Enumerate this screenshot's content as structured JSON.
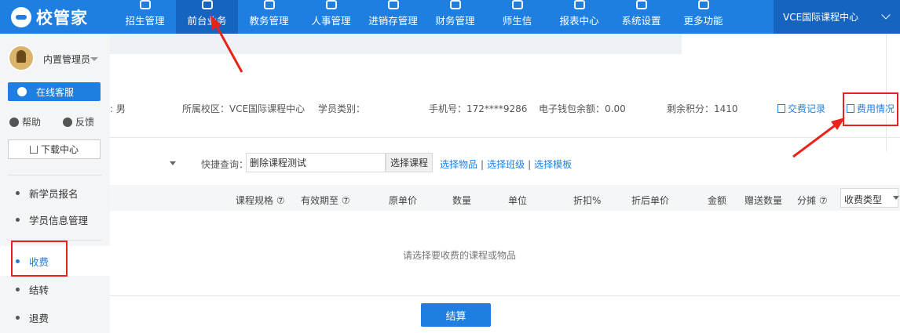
{
  "app": {
    "logo_text": "校管家"
  },
  "nav": {
    "items": [
      {
        "label": "招生管理",
        "icon": "user-add-icon"
      },
      {
        "label": "前台业务",
        "icon": "reception-icon"
      },
      {
        "label": "教务管理",
        "icon": "book-icon"
      },
      {
        "label": "人事管理",
        "icon": "person-icon"
      },
      {
        "label": "进销存管理",
        "icon": "inventory-icon"
      },
      {
        "label": "财务管理",
        "icon": "finance-icon"
      },
      {
        "label": "师生信",
        "icon": "chat-icon"
      },
      {
        "label": "报表中心",
        "icon": "report-icon"
      },
      {
        "label": "系统设置",
        "icon": "settings-icon"
      },
      {
        "label": "更多功能",
        "icon": "more-icon"
      }
    ],
    "active_index": 1,
    "campus": "VCE国际课程中心"
  },
  "sidebar": {
    "user_name": "内置管理员",
    "online_service": "在线客服",
    "help": "帮助",
    "feedback": "反馈",
    "download_center": "下载中心",
    "menu": [
      {
        "label": "新学员报名",
        "active": false
      },
      {
        "label": "学员信息管理",
        "active": false
      },
      {
        "label": "收费",
        "active": true
      },
      {
        "label": "结转",
        "active": false
      },
      {
        "label": "退费",
        "active": false
      }
    ]
  },
  "student_info": {
    "gender_partial": ": 男",
    "campus": "所属校区：VCE国际课程中心",
    "category": "学员类别：",
    "phone": "手机号：172****9286",
    "wallet": "电子钱包余额：0.00",
    "points": "剩余积分：1410",
    "payment_record": "交费记录",
    "fee_status": "费用情况"
  },
  "toolbar": {
    "quick_query_label": "快捷查询：",
    "quick_query_value": "删除课程测试",
    "select_course": "选择课程",
    "select_item": "选择物品",
    "select_class": "选择班级",
    "select_template": "选择模板",
    "separator": "|"
  },
  "table": {
    "headers": [
      "课程规格 ⑦",
      "有效期至 ⑦",
      "原单价",
      "数量",
      "单位",
      "折扣%",
      "折后单价",
      "金额",
      "赠送数量",
      "分摊 ⑦"
    ],
    "fee_type": "收费类型",
    "empty_text": "请选择要收费的课程或物品"
  },
  "actions": {
    "settle": "结算"
  },
  "annotation_color": "#e8231a",
  "accent_color": "#1f7fe0"
}
